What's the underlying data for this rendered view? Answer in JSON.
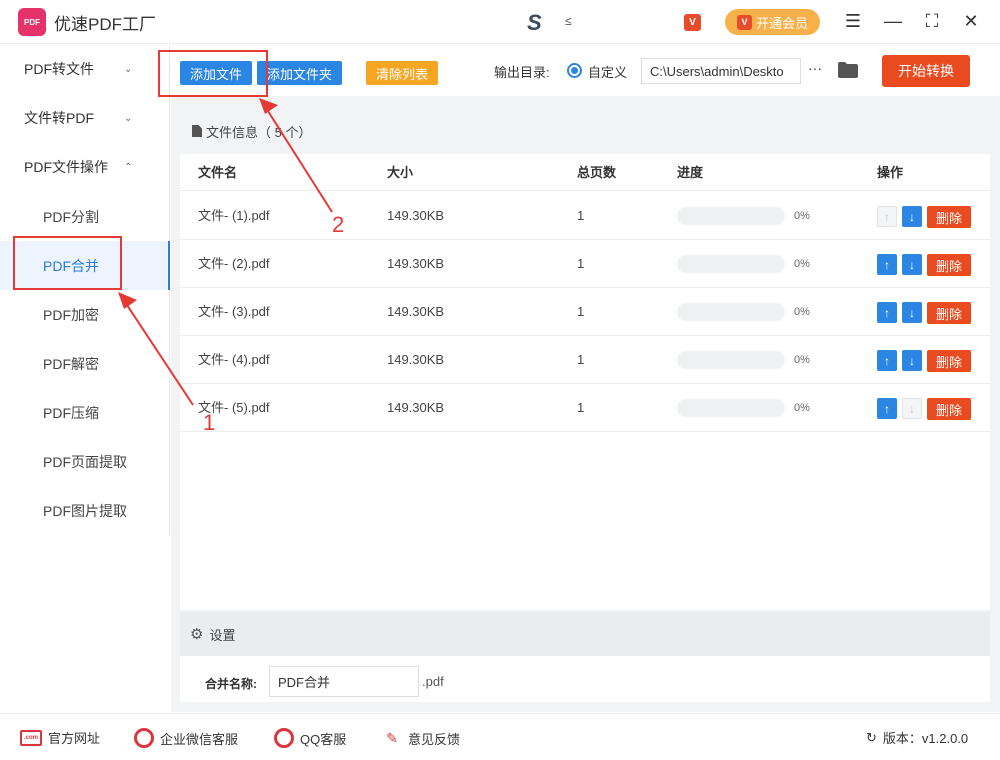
{
  "app": {
    "logo_text": "PDF",
    "title": "优速PDF工厂",
    "brand_letter": "S",
    "brand_small": "≤",
    "vip_icon_text": "V",
    "member_button": "开通会员"
  },
  "window_controls": {
    "menu": "☰",
    "minimize": "—",
    "maximize": "⛶",
    "close": "✕"
  },
  "sidebar": {
    "groups": [
      {
        "label": "PDF转文件",
        "chevron": "⌄"
      },
      {
        "label": "文件转PDF",
        "chevron": "⌄"
      },
      {
        "label": "PDF文件操作",
        "chevron": "⌃"
      }
    ],
    "items": [
      {
        "label": "PDF分割"
      },
      {
        "label": "PDF合并"
      },
      {
        "label": "PDF加密"
      },
      {
        "label": "PDF解密"
      },
      {
        "label": "PDF压缩"
      },
      {
        "label": "PDF页面提取"
      },
      {
        "label": "PDF图片提取"
      }
    ],
    "active_item": "PDF合并"
  },
  "toolbar": {
    "add_file": "添加文件",
    "add_folder": "添加文件夹",
    "clear_list": "清除列表",
    "output_label": "输出目录:",
    "radio_label": "自定义",
    "output_path": "C:\\Users\\admin\\Deskto",
    "more": "···",
    "start": "开始转换"
  },
  "file_panel": {
    "header": "文件信息（ 5 个）",
    "columns": [
      "文件名",
      "大小",
      "总页数",
      "进度",
      "操作"
    ],
    "rows": [
      {
        "name": "文件- (1).pdf",
        "size": "149.30KB",
        "pages": "1",
        "progress": "0%",
        "up_enabled": false,
        "down_enabled": true
      },
      {
        "name": "文件- (2).pdf",
        "size": "149.30KB",
        "pages": "1",
        "progress": "0%",
        "up_enabled": true,
        "down_enabled": true
      },
      {
        "name": "文件- (3).pdf",
        "size": "149.30KB",
        "pages": "1",
        "progress": "0%",
        "up_enabled": true,
        "down_enabled": true
      },
      {
        "name": "文件- (4).pdf",
        "size": "149.30KB",
        "pages": "1",
        "progress": "0%",
        "up_enabled": true,
        "down_enabled": true
      },
      {
        "name": "文件- (5).pdf",
        "size": "149.30KB",
        "pages": "1",
        "progress": "0%",
        "up_enabled": true,
        "down_enabled": false
      }
    ],
    "up_glyph": "↑",
    "down_glyph": "↓",
    "delete_label": "删除"
  },
  "settings": {
    "header": "设置",
    "merge_label": "合并名称:",
    "merge_value": "PDF合并",
    "merge_ext": ".pdf"
  },
  "footer": {
    "website": "官方网址",
    "wechat": "企业微信客服",
    "qq": "QQ客服",
    "feedback": "意见反馈",
    "version": "版本：v1.2.0.0",
    "web_icon_text": ".com"
  },
  "annotations": {
    "label_1": "1",
    "label_2": "2",
    "color": "#e53935"
  },
  "colors": {
    "primary_blue": "#2b86e3",
    "danger_red": "#ea4a1f",
    "warning_orange": "#f5a623",
    "member_gold": "#f8b04a"
  }
}
